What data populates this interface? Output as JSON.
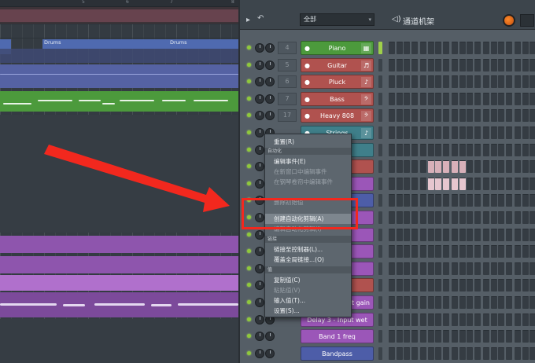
{
  "playlist": {
    "ruler_marks": [
      "5",
      "6",
      "7",
      "8"
    ],
    "drum_clip_label": "Drums"
  },
  "rack": {
    "filter_value": "全部",
    "title": "通道机架",
    "channels": [
      {
        "mixer": "4",
        "name": "Piano",
        "color": "#4c9a3c",
        "icon": "piano-icon",
        "glyph": "▦"
      },
      {
        "mixer": "5",
        "name": "Guitar",
        "color": "#b0524f",
        "icon": "guitar-icon",
        "glyph": "♬"
      },
      {
        "mixer": "6",
        "name": "Pluck",
        "color": "#b0524f",
        "icon": "pluck-icon",
        "glyph": "♪"
      },
      {
        "mixer": "7",
        "name": "Bass",
        "color": "#b0524f",
        "icon": "bass-clef-icon",
        "glyph": "𝄢"
      },
      {
        "mixer": "17",
        "name": "Heavy 808",
        "color": "#b0524f",
        "icon": "bass-clef-icon",
        "glyph": "𝄢"
      },
      {
        "mixer": "",
        "name": "Strings",
        "color": "#3f7f8a",
        "icon": "strings-icon",
        "glyph": "♪"
      },
      {
        "mixer": "",
        "name": "Delay 3 - Input wet",
        "color": "#9b56b8",
        "icon": "",
        "glyph": ""
      },
      {
        "mixer": "",
        "name": "Band 1 freq",
        "color": "#9b56b8",
        "icon": "",
        "glyph": ""
      },
      {
        "mixer": "",
        "name": "Bandpass",
        "color": "#4d5da8",
        "icon": "",
        "glyph": ""
      }
    ],
    "partial_label": "et gain"
  },
  "context_menu": {
    "reset": "重置(R)",
    "header_automation": "自动化",
    "edit_events": "编辑事件(E)",
    "edit_events_new_window": "在新窗口中编辑事件",
    "edit_events_piano_roll": "在钢琴卷帘中编辑事件",
    "delete_initial": "删除初始值",
    "create_automation_clip": "创建自动化剪辑(A)",
    "edit_automation_clip": "编辑自动化剪辑(I)",
    "header_link": "链接",
    "link_controller": "链接至控制器(L)...",
    "override_global": "覆盖全局链接...(O)",
    "header_value": "值",
    "copy_value": "复制值(C)",
    "paste_value": "粘贴值(V)",
    "type_value": "输入值(T)...",
    "settings": "设置(S)..."
  }
}
